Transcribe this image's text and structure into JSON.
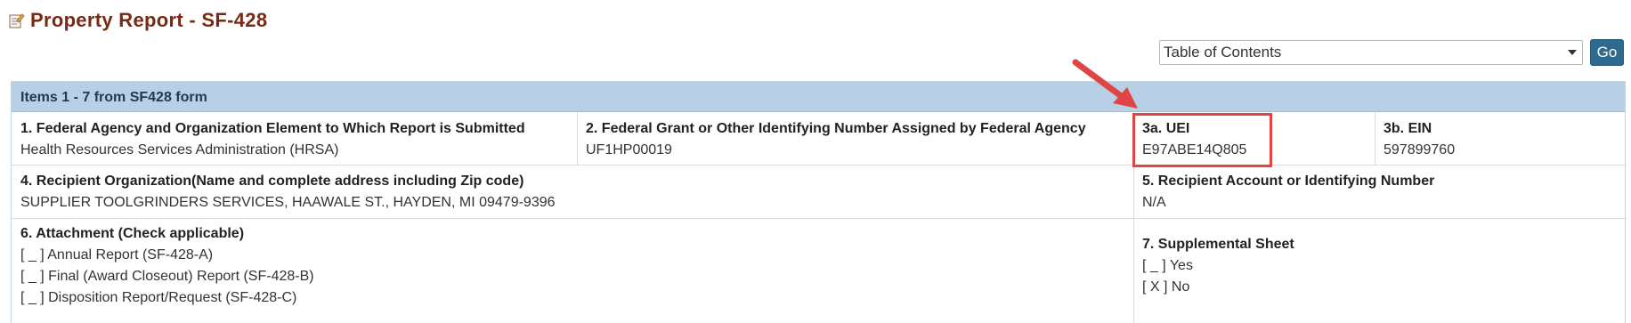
{
  "page": {
    "title": "Property Report - SF-428"
  },
  "toc": {
    "selected": "Table of Contents",
    "go_label": "Go"
  },
  "section": {
    "header": "Items 1 - 7 from SF428 form"
  },
  "fields": {
    "item1": {
      "label": "1. Federal Agency and Organization Element to Which Report is Submitted",
      "value": "Health Resources Services Administration (HRSA)"
    },
    "item2": {
      "label": "2. Federal Grant or Other Identifying Number Assigned by Federal Agency",
      "value": "UF1HP00019"
    },
    "item3a": {
      "label": "3a. UEI",
      "value": "E97ABE14Q805"
    },
    "item3b": {
      "label": "3b. EIN",
      "value": "597899760"
    },
    "item4": {
      "label": "4. Recipient Organization(Name and complete address including Zip code)",
      "value": "SUPPLIER TOOLGRINDERS SERVICES, HAAWALE ST., HAYDEN, MI 09479-9396"
    },
    "item5": {
      "label": "5. Recipient Account or Identifying Number",
      "value": "N/A"
    },
    "item6": {
      "label": "6. Attachment (Check applicable)",
      "options": [
        "[ _ ] Annual Report (SF-428-A)",
        "[ _ ] Final (Award Closeout) Report (SF-428-B)",
        "[ _ ] Disposition Report/Request (SF-428-C)"
      ]
    },
    "item7": {
      "label": "7. Supplemental Sheet",
      "options": [
        "[ _ ] Yes",
        "[ X ] No"
      ]
    }
  },
  "colors": {
    "title": "#7a2a14",
    "header_bg": "#b7d0e6",
    "go_button": "#2d6a8e",
    "highlight": "#e04444"
  }
}
